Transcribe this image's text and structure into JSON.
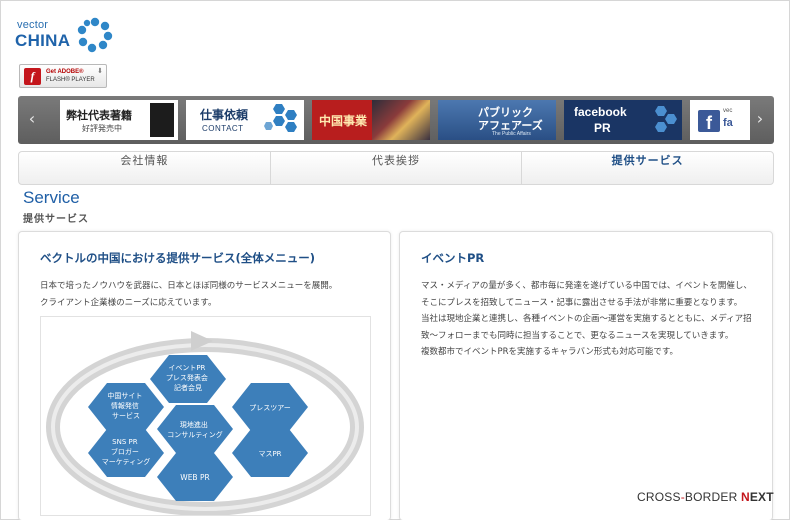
{
  "logo": {
    "line1": "vector",
    "line2": "CHINA"
  },
  "flash": {
    "line1": "Get ADOBE®",
    "line2": "FLASH® PLAYER"
  },
  "carousel": {
    "prev": "‹",
    "next": "›",
    "slides": [
      {
        "line1": "弊社代表著籍",
        "line2": "好評発売中"
      },
      {
        "line1": "仕事依頼",
        "line2": "CONTACT"
      },
      {
        "line1": "中国事業"
      },
      {
        "line1": "パブリック",
        "line2": "アフェアーズ",
        "line3": "The Public Affairs"
      },
      {
        "line1": "facebook",
        "line2": "PR"
      },
      {
        "line1": "vec",
        "line2": "fa"
      }
    ]
  },
  "nav": {
    "tabs": [
      "会社情報",
      "代表挨拶",
      "提供サービス"
    ]
  },
  "page": {
    "title": "Service",
    "subtitle": "提供サービス"
  },
  "left_panel": {
    "heading": "ベクトルの中国における提供サービス(全体メニュー)",
    "lines": [
      "日本で培ったノウハウを武器に、日本とほぼ同様のサービスメニューを展開。",
      "クライアント企業様のニーズに応えています。"
    ],
    "diagram": {
      "hexes": [
        {
          "lines": [
            "イベントPR",
            "プレス発表会",
            "記者会見"
          ]
        },
        {
          "lines": [
            "中国サイト",
            "情報発信",
            "サービス"
          ]
        },
        {
          "lines": [
            "プレスツアー"
          ]
        },
        {
          "lines": [
            "現地進出",
            "コンサルティング"
          ]
        },
        {
          "lines": [
            "SNS PR",
            "ブロガー",
            "マーケティング"
          ]
        },
        {
          "lines": [
            "マスPR"
          ]
        },
        {
          "lines": [
            "WEB PR"
          ]
        }
      ]
    }
  },
  "right_panel": {
    "heading": "イベントPR",
    "lines": [
      "マス・メディアの量が多く、都市毎に発達を遂げている中国では、イベントを開催し、",
      "そこにプレスを招致してニュース・記事に露出させる手法が非常に重要となります。",
      "当社は現地企業と連携し、各種イベントの企画～運営を実施するとともに、メディア招",
      "致～フォローまでも同時に担当することで、更なるニュースを実現していきます。",
      "複数都市でイベントPRを実施するキャラバン形式も対応可能です。"
    ]
  },
  "footer": {
    "part1": "CROSS",
    "dash": "-",
    "part2": "BORDER ",
    "n": "N",
    "ext": "EXT"
  },
  "colors": {
    "accent": "#1f5fa6",
    "hex_fill": "#3d7fba",
    "red": "#c4161c"
  }
}
